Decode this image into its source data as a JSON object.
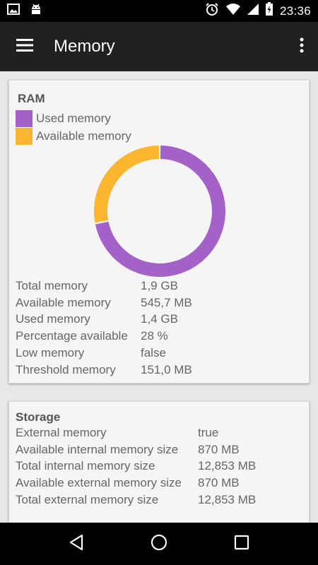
{
  "status_bar": {
    "time": "23:36",
    "icons": [
      "image-icon",
      "android-icon",
      "alarm-icon",
      "wifi-icon",
      "battery-icon"
    ]
  },
  "app_bar": {
    "title": "Memory",
    "left_icon": "menu-icon",
    "right_icon": "more-vert-icon"
  },
  "ram": {
    "title": "RAM",
    "legend": [
      {
        "label": "Used memory",
        "color": "#a462c8"
      },
      {
        "label": "Available memory",
        "color": "#fbb52e"
      }
    ],
    "rows": [
      {
        "key": "Total memory",
        "value": "1,9 GB"
      },
      {
        "key": "Available memory",
        "value": "545,7 MB"
      },
      {
        "key": "Used memory",
        "value": "1,4 GB"
      },
      {
        "key": "Percentage available",
        "value": "28 %"
      },
      {
        "key": "Low memory",
        "value": "false"
      },
      {
        "key": "Threshold memory",
        "value": "151,0 MB"
      }
    ]
  },
  "chart_data": {
    "type": "pie",
    "categories": [
      "Used memory",
      "Available memory"
    ],
    "values": [
      72,
      28
    ],
    "colors": [
      "#a462c8",
      "#fbb52e"
    ],
    "title": "",
    "donut": true
  },
  "storage": {
    "title": "Storage",
    "rows": [
      {
        "key": "External memory",
        "value": "true"
      },
      {
        "key": "Available internal memory size",
        "value": "870 MB"
      },
      {
        "key": "Total internal memory size",
        "value": "12,853 MB"
      },
      {
        "key": "Available external memory size",
        "value": "870 MB"
      },
      {
        "key": "Total external memory size",
        "value": "12,853 MB"
      }
    ]
  },
  "nav_bar": {
    "icons": [
      "back-icon",
      "home-icon",
      "recents-icon"
    ]
  }
}
